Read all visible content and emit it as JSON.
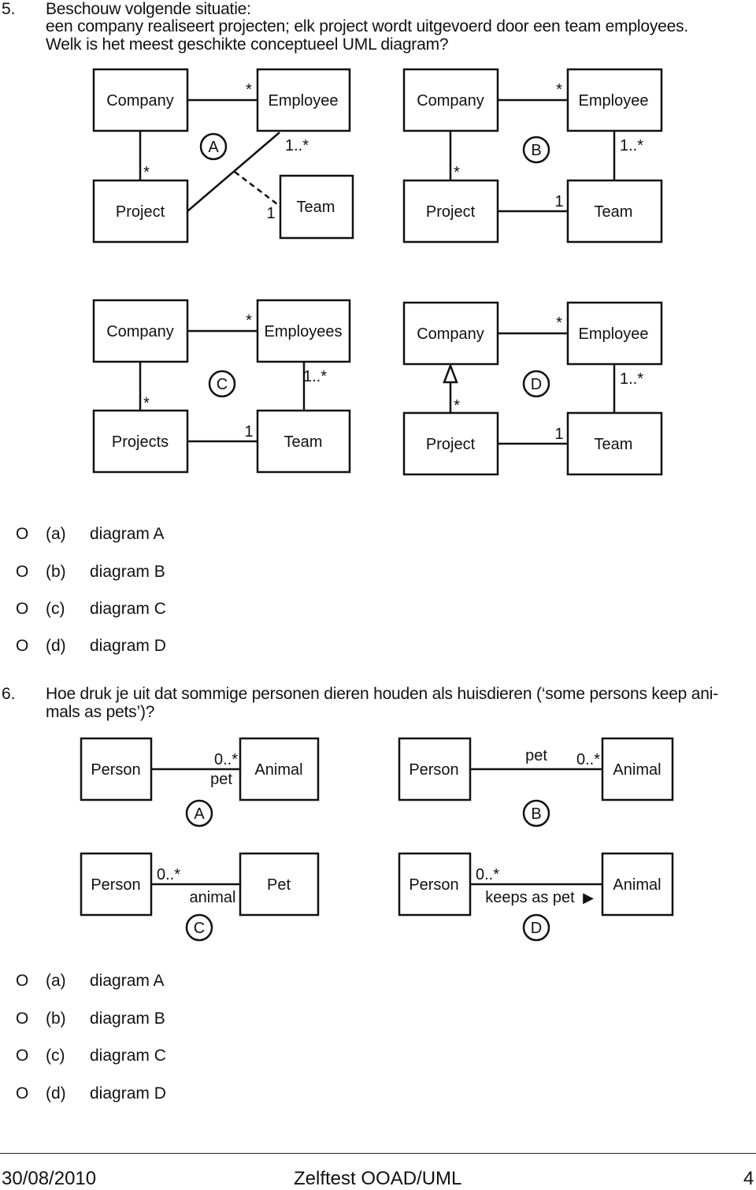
{
  "question5": {
    "number": "5.",
    "lines": [
      "Beschouw volgende situatie:",
      "een company realiseert projecten; elk project wordt uitgevoerd door een team employees.",
      "Welk is het meest geschikte conceptueel UML diagram?"
    ],
    "diagrams": [
      {
        "label": "A",
        "classes": {
          "topLeft": "Company",
          "topRight": "Employee",
          "bottomLeft": "Project",
          "bottomRight": "Team"
        },
        "multiplicities": {
          "companyEmployee": "*",
          "companyProject": "*",
          "employeeProject": "1..*",
          "team": "1"
        },
        "association_class_link": "dashed"
      },
      {
        "label": "B",
        "classes": {
          "topLeft": "Company",
          "topRight": "Employee",
          "bottomLeft": "Project",
          "bottomRight": "Team"
        },
        "multiplicities": {
          "companyEmployee": "*",
          "companyProject": "*",
          "employeeTeam": "1..*",
          "projectTeam": "1"
        }
      },
      {
        "label": "C",
        "classes": {
          "topLeft": "Company",
          "topRight": "Employees",
          "bottomLeft": "Projects",
          "bottomRight": "Team"
        },
        "multiplicities": {
          "companyEmployee": "*",
          "companyProject": "*",
          "employeeTeam": "1..*",
          "projectTeam": "1"
        }
      },
      {
        "label": "D",
        "classes": {
          "topLeft": "Company",
          "topRight": "Employee",
          "bottomLeft": "Project",
          "bottomRight": "Team"
        },
        "multiplicities": {
          "companyEmployee": "*",
          "companyProject": "*",
          "employeeTeam": "1..*",
          "projectTeam": "1"
        },
        "generalization": true
      }
    ],
    "options": [
      {
        "bullet": "O",
        "letter": "(a)",
        "text": "diagram A"
      },
      {
        "bullet": "O",
        "letter": "(b)",
        "text": "diagram B"
      },
      {
        "bullet": "O",
        "letter": "(c)",
        "text": "diagram C"
      },
      {
        "bullet": "O",
        "letter": "(d)",
        "text": "diagram D"
      }
    ]
  },
  "question6": {
    "number": "6.",
    "lines": [
      "Hoe druk je uit dat sommige personen dieren houden als huisdieren (‘some persons keep ani-",
      "mals as pets’)?"
    ],
    "diagrams": [
      {
        "label": "A",
        "left": "Person",
        "right": "Animal",
        "multiplicity": "0..*",
        "role": "pet"
      },
      {
        "label": "B",
        "left": "Person",
        "right": "Animal",
        "multiplicity": "0..*",
        "role": "pet"
      },
      {
        "label": "C",
        "left": "Person",
        "right": "Pet",
        "multiplicity": "0..*",
        "role": "animal"
      },
      {
        "label": "D",
        "left": "Person",
        "right": "Animal",
        "multiplicity": "0..*",
        "role": "keeps as pet",
        "direction_arrow": "▶"
      }
    ],
    "options": [
      {
        "bullet": "O",
        "letter": "(a)",
        "text": "diagram A"
      },
      {
        "bullet": "O",
        "letter": "(b)",
        "text": "diagram B"
      },
      {
        "bullet": "O",
        "letter": "(c)",
        "text": "diagram C"
      },
      {
        "bullet": "O",
        "letter": "(d)",
        "text": "diagram D"
      }
    ]
  },
  "footer": {
    "date": "30/08/2010",
    "title": "Zelftest OOAD/UML",
    "page": "4"
  }
}
